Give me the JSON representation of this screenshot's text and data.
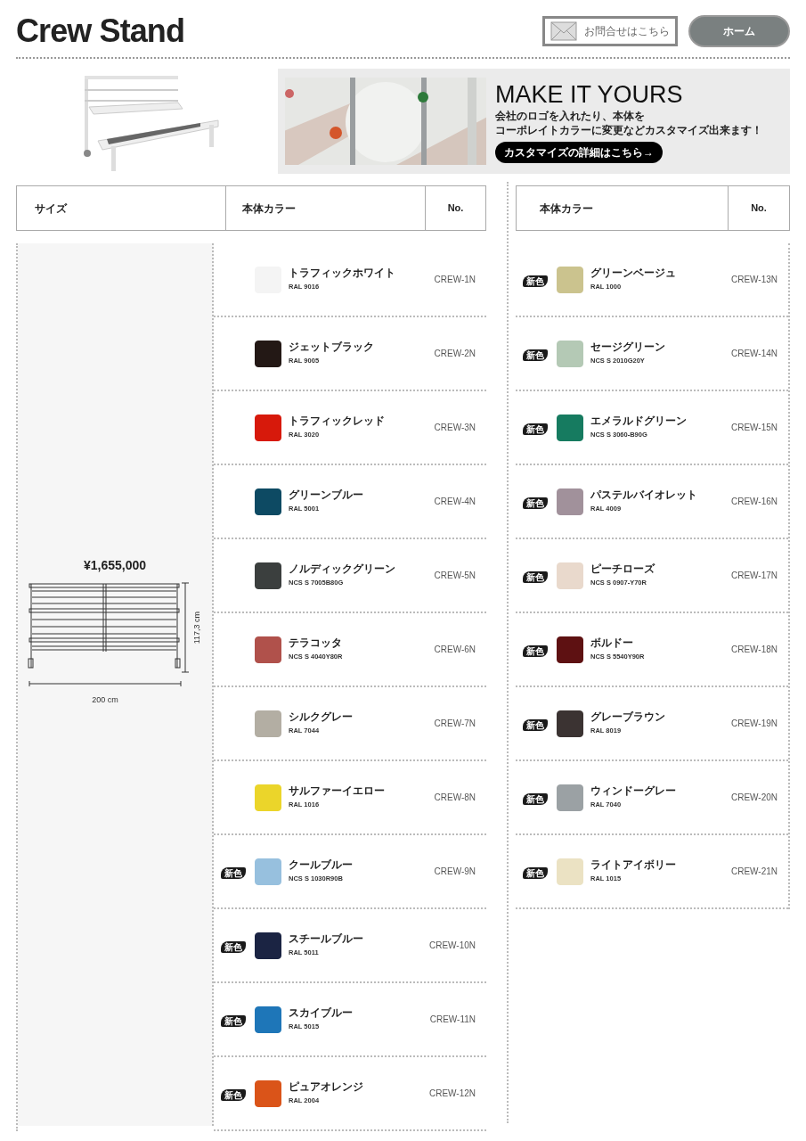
{
  "header": {
    "title": "Crew Stand",
    "contact_button": "お問合せはこちら",
    "home_button": "ホーム"
  },
  "banner": {
    "heading": "MAKE IT YOURS",
    "lines": [
      "会社のロゴを入れたり、本体を",
      "コーポレイトカラーに変更などカスタマイズ出来ます！"
    ],
    "link": "カスタマイズの詳細はこちら→"
  },
  "left_table": {
    "columns": [
      "サイズ",
      "本体カラー",
      "No."
    ],
    "size": {
      "price": "¥1,655,000",
      "height": "117,3 cm",
      "width": "200 cm"
    },
    "rows": [
      {
        "name": "トラフィックホワイト",
        "code": "RAL 9016",
        "no": "CREW-1N",
        "color": "#f4f4f4"
      },
      {
        "name": "ジェットブラック",
        "code": "RAL 9005",
        "no": "CREW-2N",
        "color": "#231815"
      },
      {
        "name": "トラフィックレッド",
        "code": "RAL 3020",
        "no": "CREW-3N",
        "color": "#d7190b"
      },
      {
        "name": "グリーンブルー",
        "code": "RAL 5001",
        "no": "CREW-4N",
        "color": "#0d4a63"
      },
      {
        "name": "ノルディックグリーン",
        "code": "NCS S 7005B80G",
        "no": "CREW-5N",
        "color": "#3b3f3e"
      },
      {
        "name": "テラコッタ",
        "code": "NCS S 4040Y80R",
        "no": "CREW-6N",
        "color": "#b0514b"
      },
      {
        "name": "シルクグレー",
        "code": "RAL 7044",
        "no": "CREW-7N",
        "color": "#b3aea3"
      },
      {
        "name": "サルファーイエロー",
        "code": "RAL 1016",
        "no": "CREW-8N",
        "color": "#ebd52a"
      },
      {
        "name": "クールブルー",
        "code": "NCS S 1030R90B",
        "no": "CREW-9N",
        "color": "#97c0de",
        "badge": "新色"
      },
      {
        "name": "スチールブルー",
        "code": "RAL 5011",
        "no": "CREW-10N",
        "color": "#1b2443",
        "badge": "新色"
      },
      {
        "name": "スカイブルー",
        "code": "RAL 5015",
        "no": "CREW-11N",
        "color": "#1e76b8",
        "badge": "新色"
      },
      {
        "name": "ピュアオレンジ",
        "code": "RAL 2004",
        "no": "CREW-12N",
        "color": "#da5419",
        "badge": "新色"
      }
    ]
  },
  "right_table": {
    "columns": [
      "本体カラー",
      "No."
    ],
    "rows": [
      {
        "name": "グリーンベージュ",
        "code": "RAL 1000",
        "no": "CREW-13N",
        "color": "#cbc38e",
        "badge": "新色"
      },
      {
        "name": "セージグリーン",
        "code": "NCS S 2010G20Y",
        "no": "CREW-14N",
        "color": "#b4c9b5",
        "badge": "新色"
      },
      {
        "name": "エメラルドグリーン",
        "code": "NCS S 3060-B90G",
        "no": "CREW-15N",
        "color": "#167b60",
        "badge": "新色"
      },
      {
        "name": "パステルバイオレット",
        "code": "RAL 4009",
        "no": "CREW-16N",
        "color": "#a1919b",
        "badge": "新色"
      },
      {
        "name": "ピーチローズ",
        "code": "NCS S 0907-Y70R",
        "no": "CREW-17N",
        "color": "#e9d9cc",
        "badge": "新色"
      },
      {
        "name": "ボルドー",
        "code": "NCS S 5540Y90R",
        "no": "CREW-18N",
        "color": "#5e1112",
        "badge": "新色"
      },
      {
        "name": "グレーブラウン",
        "code": "RAL 8019",
        "no": "CREW-19N",
        "color": "#3b3332",
        "badge": "新色"
      },
      {
        "name": "ウィンドーグレー",
        "code": "RAL 7040",
        "no": "CREW-20N",
        "color": "#9ba1a4",
        "badge": "新色"
      },
      {
        "name": "ライトアイボリー",
        "code": "RAL 1015",
        "no": "CREW-21N",
        "color": "#ebe2c3",
        "badge": "新色"
      }
    ]
  }
}
